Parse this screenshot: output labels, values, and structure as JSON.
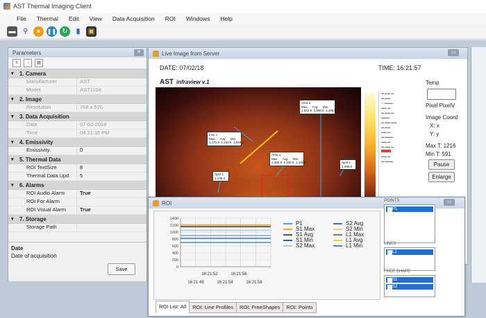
{
  "window": {
    "title": "AST Thermal Imaging Client"
  },
  "menu": [
    "File",
    "Thermal",
    "Edit",
    "View",
    "Data Acquisition",
    "ROI",
    "Windows",
    "Help"
  ],
  "toolbar": [
    "camera-icon",
    "search-icon",
    "record-icon",
    "pause-icon",
    "refresh-icon",
    "chart-icon",
    "film-icon"
  ],
  "parameters": {
    "title": "Parameters",
    "categories": [
      {
        "label": "1. Camera",
        "props": [
          {
            "key": "Manufacturer",
            "value": "AST",
            "readonly": true
          },
          {
            "key": "Model",
            "value": "AST1104",
            "readonly": true
          }
        ]
      },
      {
        "label": "2. Image",
        "props": [
          {
            "key": "Resolution",
            "value": "768 x 576",
            "readonly": true
          }
        ]
      },
      {
        "label": "3. Data Acquisition",
        "props": [
          {
            "key": "Date",
            "value": "07-02-2018",
            "readonly": true
          },
          {
            "key": "Time",
            "value": "04:21:35 PM",
            "readonly": true
          }
        ]
      },
      {
        "label": "4. Emissivity",
        "props": [
          {
            "key": "Emissivity",
            "value": "0"
          }
        ]
      },
      {
        "label": "5. Thermal Data",
        "props": [
          {
            "key": "ROI TextSize",
            "value": "8"
          },
          {
            "key": "Thermal Data Upd",
            "value": "5"
          }
        ]
      },
      {
        "label": "6. Alarms",
        "props": [
          {
            "key": "ROI Audio Alarm",
            "value": "True",
            "bold": true
          },
          {
            "key": "ROI For Alarm",
            "value": ""
          },
          {
            "key": "ROI Visual Alarm",
            "value": "True",
            "bold": true
          }
        ]
      },
      {
        "label": "7. Storage",
        "props": [
          {
            "key": "Storage Path",
            "value": ""
          }
        ]
      }
    ],
    "desc_title": "Date",
    "desc_text": "Date of acquisition",
    "save_label": "Save"
  },
  "live": {
    "title": "Live Image from Server",
    "date_label": "DATE: 07/02/18",
    "time_label": "TIME: 16:21:57",
    "logo": "AST",
    "logo_sub": "infraview v.1",
    "annotations": [
      {
        "name": "Line 1",
        "text": "Line 1\nMax.     Avg.     Min.\n1,175.9  1,150.6  1,050.6"
      },
      {
        "name": "Area 1",
        "text": "Area 1\nMax.     Avg.     Min.\n1,368.9  1,200.8  1,155.6"
      },
      {
        "name": "Area 2",
        "text": "Area 2\nMax.     Avg.     Min.\n1,522.9  1,390.5  1,236.0"
      },
      {
        "name": "Spot 1",
        "text": "Spot 1\n1,108.3"
      },
      {
        "name": "Spot 2",
        "text": "Spot 1\n1,095.9"
      }
    ],
    "temp_label": "Temp",
    "pixel_labels": "Pixel  PixelV",
    "image_coord": "Image Coord",
    "coord_xy": [
      "X:  x",
      "Y:  y"
    ],
    "max_t": "Max T: 1216",
    "min_t": "Min T: 591",
    "pause_label": "Pause",
    "enlarge_label": "Enlarge"
  },
  "roi": {
    "title": "ROI",
    "groups": [
      {
        "label": "POINTS",
        "items": [
          "P1"
        ]
      },
      {
        "label": "LINES",
        "items": [
          "L1"
        ]
      },
      {
        "label": "FREE SHAPE",
        "items": [
          "S1",
          "S2"
        ]
      }
    ],
    "legend": [
      {
        "name": "P1",
        "color": "#4aa3df"
      },
      {
        "name": "S1 Max",
        "color": "#f0a830"
      },
      {
        "name": "S1 Avg",
        "color": "#555555"
      },
      {
        "name": "S1 Min",
        "color": "#2f5fa8"
      },
      {
        "name": "S2 Max",
        "color": "#a7c7e0"
      },
      {
        "name": "S2 Avg",
        "color": "#3b6fb0"
      },
      {
        "name": "S2 Min",
        "color": "#f3c98b"
      },
      {
        "name": "L1 Max",
        "color": "#7a7a7a"
      },
      {
        "name": "L1 Avg",
        "color": "#f1cf3a"
      },
      {
        "name": "L1 Min",
        "color": "#4b86c6"
      }
    ],
    "tabs": [
      "ROI List: All",
      "ROI: Line Profiles",
      "ROI: FreeShapes",
      "ROI: Points"
    ]
  },
  "chart_data": {
    "type": "line",
    "yticks": [
      1400,
      1200,
      1000,
      800,
      600,
      400,
      200,
      0
    ],
    "ylim": [
      0,
      1400
    ],
    "xticks_top": [
      "16:21:52",
      "16:21:56"
    ],
    "xticks_bottom": [
      "16:21:49",
      "16:21:54",
      "16:21:58"
    ],
    "series": [
      {
        "name": "S1 Max",
        "values": [
          1216,
          1216,
          1216,
          1216,
          1216,
          1216,
          1216
        ]
      },
      {
        "name": "L1 Max",
        "values": [
          1175,
          1175,
          1175,
          1175,
          1175,
          1175,
          1175
        ]
      },
      {
        "name": "S1 Avg",
        "values": [
          1150,
          1150,
          1150,
          1150,
          1150,
          1150,
          1150
        ]
      },
      {
        "name": "S2 Max",
        "values": [
          1050,
          1050,
          1050,
          1050,
          1050,
          1050,
          1050
        ]
      },
      {
        "name": "P1",
        "values": [
          900,
          900,
          900,
          900,
          900,
          900,
          900
        ]
      },
      {
        "name": "S1 Min",
        "values": [
          820,
          820,
          820,
          820,
          820,
          820,
          820
        ]
      },
      {
        "name": "S2 Avg",
        "values": [
          700,
          700,
          700,
          700,
          700,
          700,
          700
        ]
      }
    ]
  }
}
